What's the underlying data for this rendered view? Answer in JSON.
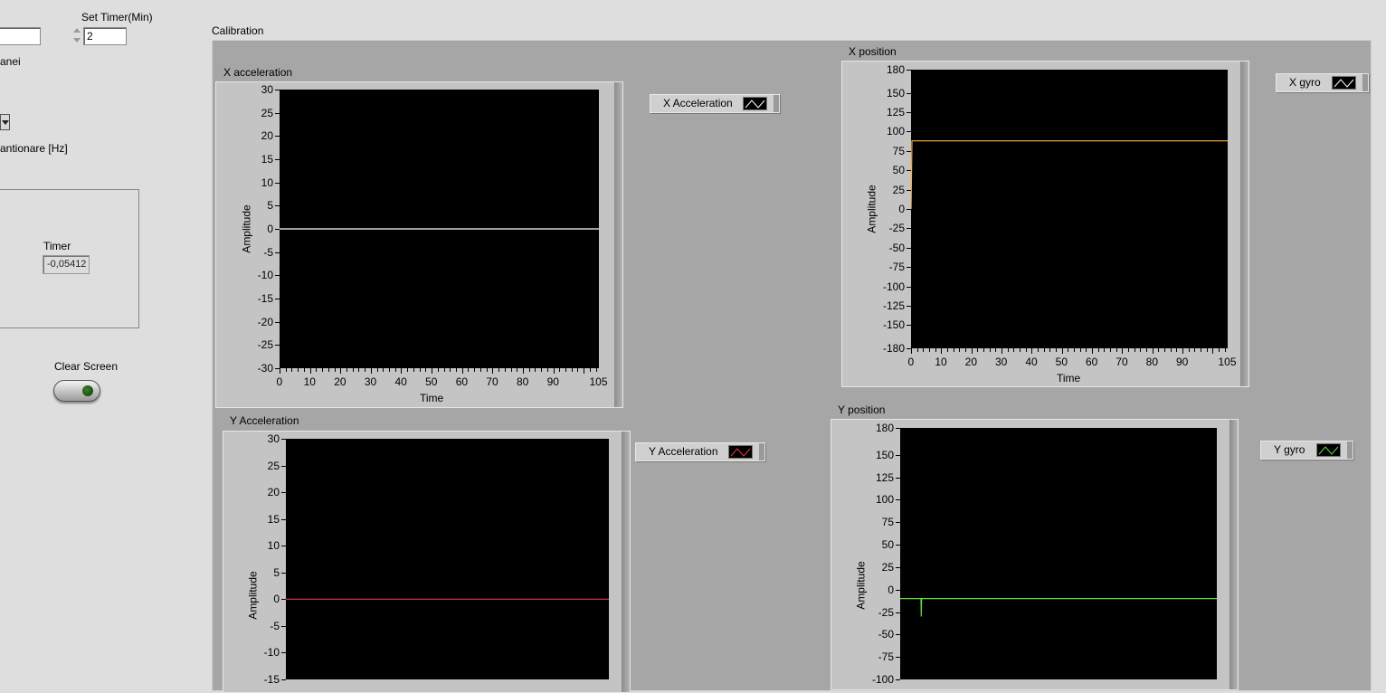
{
  "controls": {
    "set_timer_label": "Set Timer(Min)",
    "set_timer_value": "2",
    "panel_label_partial": "anei",
    "sample_rate_label_partial": "antionare [Hz]",
    "timer_label": "Timer",
    "timer_value": "-0,05412",
    "clear_screen_label": "Clear Screen"
  },
  "tab": {
    "label": "Calibration"
  },
  "graphs": {
    "x_accel": {
      "title": "X  acceleration",
      "ylabel": "Amplitude",
      "xlabel": "Time",
      "yticks": [
        "30",
        "25",
        "20",
        "15",
        "10",
        "5",
        "0",
        "-5",
        "-10",
        "-15",
        "-20",
        "-25",
        "-30"
      ],
      "xticks": [
        "0",
        "10",
        "20",
        "30",
        "40",
        "50",
        "60",
        "70",
        "80",
        "90",
        "105"
      ],
      "legend": "X Acceleration"
    },
    "x_pos": {
      "title": "X  position",
      "ylabel": "Amplitude",
      "xlabel": "Time",
      "yticks": [
        "180",
        "150",
        "125",
        "100",
        "75",
        "50",
        "25",
        "0",
        "-25",
        "-50",
        "-75",
        "-100",
        "-125",
        "-150",
        "-180"
      ],
      "xticks": [
        "0",
        "10",
        "20",
        "30",
        "40",
        "50",
        "60",
        "70",
        "80",
        "90",
        "105"
      ],
      "legend": "X gyro"
    },
    "y_accel": {
      "title": "Y Acceleration",
      "ylabel": "Amplitude",
      "yticks": [
        "30",
        "25",
        "20",
        "15",
        "10",
        "5",
        "0",
        "-5",
        "-10",
        "-15"
      ],
      "legend": "Y Acceleration"
    },
    "y_pos": {
      "title": "Y position",
      "ylabel": "Amplitude",
      "yticks": [
        "180",
        "150",
        "125",
        "100",
        "75",
        "50",
        "25",
        "0",
        "-25",
        "-50",
        "-75",
        "-100"
      ],
      "legend": "Y gyro"
    }
  },
  "colors": {
    "x_accel_trace": "#ffffff",
    "x_pos_trace": "#ffb347",
    "y_accel_trace": "#e23b3b",
    "y_pos_trace": "#63e03a"
  },
  "chart_data": [
    {
      "type": "line",
      "title": "X  acceleration",
      "xlabel": "Time",
      "ylabel": "Amplitude",
      "xlim": [
        0,
        105
      ],
      "ylim": [
        -30,
        30
      ],
      "series": [
        {
          "name": "X Acceleration",
          "x": [
            0,
            105
          ],
          "y": [
            0,
            0
          ]
        }
      ]
    },
    {
      "type": "line",
      "title": "X  position",
      "xlabel": "Time",
      "ylabel": "Amplitude",
      "xlim": [
        0,
        105
      ],
      "ylim": [
        -180,
        180
      ],
      "series": [
        {
          "name": "X gyro",
          "x": [
            0,
            0.3,
            1,
            105
          ],
          "y": [
            0,
            88,
            88,
            88
          ]
        }
      ]
    },
    {
      "type": "line",
      "title": "Y Acceleration",
      "ylabel": "Amplitude",
      "xlim": [
        0,
        105
      ],
      "ylim": [
        -15,
        30
      ],
      "series": [
        {
          "name": "Y Acceleration",
          "x": [
            0,
            105
          ],
          "y": [
            0,
            0
          ]
        }
      ]
    },
    {
      "type": "line",
      "title": "Y position",
      "ylabel": "Amplitude",
      "xlim": [
        0,
        105
      ],
      "ylim": [
        -100,
        180
      ],
      "series": [
        {
          "name": "Y gyro",
          "x": [
            0,
            6.9,
            7,
            7.1,
            105
          ],
          "y": [
            -10,
            -10,
            -30,
            -10,
            -10
          ]
        }
      ]
    }
  ]
}
